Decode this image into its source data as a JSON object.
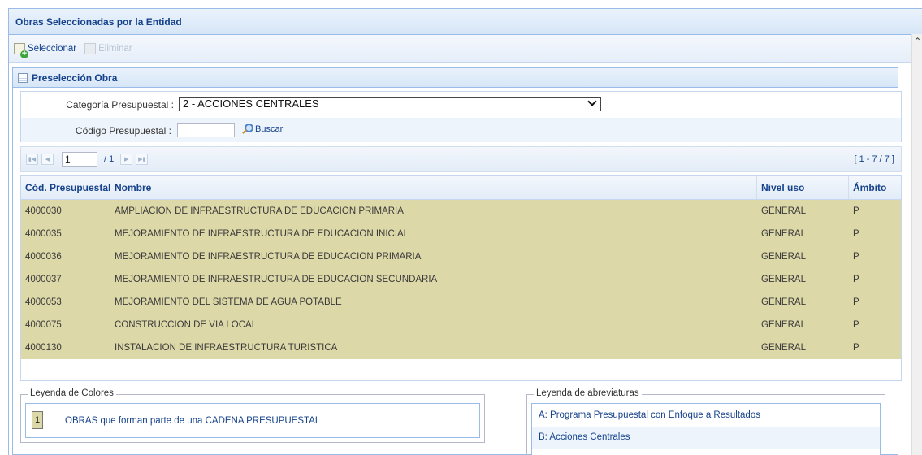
{
  "window": {
    "title": "Obras Seleccionadas por la Entidad"
  },
  "toolbar": {
    "select_label": "Seleccionar",
    "delete_label": "Eliminar"
  },
  "panel": {
    "title": "Preselección Obra"
  },
  "form": {
    "categoria_label": "Categoría Presupuestal :",
    "categoria_value": "2 - ACCIONES CENTRALES",
    "codigo_label": "Código Presupuestal :",
    "codigo_value": "",
    "buscar_label": "Buscar"
  },
  "pager": {
    "page": "1",
    "total_pages": "/ 1",
    "range": "[ 1 - 7 / 7 ]"
  },
  "grid": {
    "headers": [
      "Cód. Presupuestal",
      "Nombre",
      "Nivel uso",
      "Ámbito"
    ],
    "rows": [
      [
        "4000030",
        "AMPLIACION DE INFRAESTRUCTURA DE EDUCACION PRIMARIA",
        "GENERAL",
        "P"
      ],
      [
        "4000035",
        "MEJORAMIENTO DE INFRAESTRUCTURA DE EDUCACION INICIAL",
        "GENERAL",
        "P"
      ],
      [
        "4000036",
        "MEJORAMIENTO DE INFRAESTRUCTURA DE EDUCACION PRIMARIA",
        "GENERAL",
        "P"
      ],
      [
        "4000037",
        "MEJORAMIENTO DE INFRAESTRUCTURA DE EDUCACION SECUNDARIA",
        "GENERAL",
        "P"
      ],
      [
        "4000053",
        "MEJORAMIENTO DEL SISTEMA DE AGUA POTABLE",
        "GENERAL",
        "P"
      ],
      [
        "4000075",
        "CONSTRUCCION DE VIA LOCAL",
        "GENERAL",
        "P"
      ],
      [
        "4000130",
        "INSTALACION DE INFRAESTRUCTURA TURISTICA",
        "GENERAL",
        "P"
      ]
    ]
  },
  "legend_colors": {
    "title": "Leyenda de Colores",
    "swatch_number": "1",
    "text": "OBRAS que forman parte de una CADENA PRESUPUESTAL",
    "color": "#ddd8a8"
  },
  "legend_abbr": {
    "title": "Leyenda de abreviaturas",
    "items": [
      "A: Programa Presupuestal con Enfoque a Resultados",
      "B: Acciones Centrales"
    ]
  }
}
